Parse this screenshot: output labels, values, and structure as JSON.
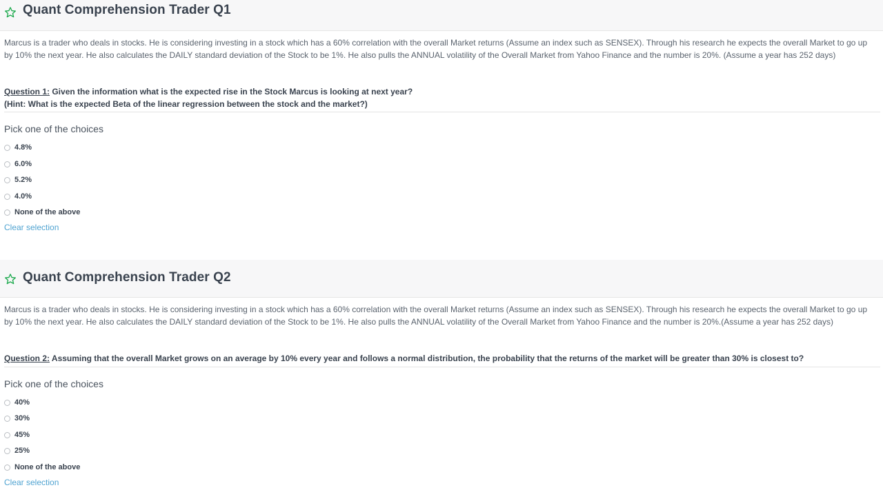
{
  "questions": [
    {
      "title": "Quant Comprehension Trader Q1",
      "passage": "Marcus is a trader who deals in stocks. He is considering investing in a stock which has a 60% correlation with the overall Market returns (Assume an index such as SENSEX). Through his research he expects the overall Market to go up by 10% the next year. He also calculates the DAILY standard deviation of the Stock to be 1%. He also pulls the ANNUAL volatility of the Overall Market from Yahoo Finance and the number is 20%. (Assume a year has 252 days)",
      "question_label": "Question 1:",
      "question_text": " Given the information what is the expected rise in the Stock Marcus is looking at next year?",
      "hint": "(Hint: What is the expected Beta of the linear regression between the stock and the market?)",
      "pick_label": "Pick one of the choices",
      "choices": [
        "4.8%",
        "6.0%",
        "5.2%",
        "4.0%",
        "None of the above"
      ],
      "clear_label": "Clear selection"
    },
    {
      "title": "Quant Comprehension Trader Q2",
      "passage": "Marcus is a trader who deals in stocks. He is considering investing in a stock which has a 60% correlation with the overall Market returns (Assume an index such as SENSEX). Through his research he expects the overall Market to go up by 10% the next year. He also calculates the DAILY standard deviation of the Stock to be 1%. He also pulls the ANNUAL volatility of the Overall Market from Yahoo Finance and the number is 20%.(Assume a year has 252 days)",
      "question_label": "Question 2:",
      "question_text": " Assuming that the overall Market grows on an average by 10% every year and follows a normal distribution, the probability that the returns of the market will be greater than 30% is closest to?",
      "pick_label": "Pick one of the choices",
      "choices": [
        "40%",
        "30%",
        "45%",
        "25%",
        "None of the above"
      ],
      "clear_label": "Clear selection"
    }
  ],
  "colors": {
    "star": "#1ba94c",
    "link": "#4fa3d1",
    "heading": "#39424e"
  },
  "icons": {
    "favorite": "star-outline-icon"
  }
}
